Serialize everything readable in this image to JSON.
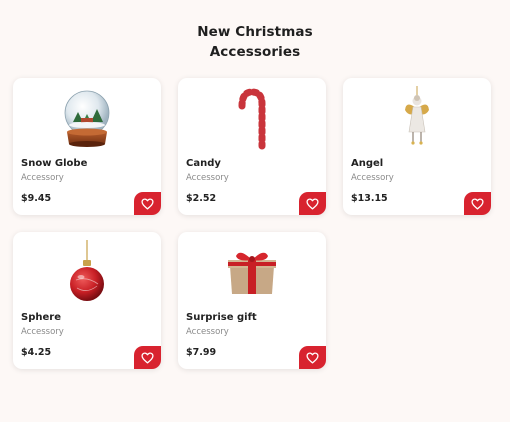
{
  "page": {
    "title_line1": "New Christmas",
    "title_line2": "Accessories"
  },
  "colors": {
    "accent": "#d8232f",
    "background": "#fdf8f6",
    "card": "#ffffff"
  },
  "products": [
    {
      "name": "Snow Globe",
      "category": "Accessory",
      "price": "$9.45",
      "icon": "snow-globe-icon"
    },
    {
      "name": "Candy",
      "category": "Accessory",
      "price": "$2.52",
      "icon": "candy-cane-icon"
    },
    {
      "name": "Angel",
      "category": "Accessory",
      "price": "$13.15",
      "icon": "angel-ornament-icon"
    },
    {
      "name": "Sphere",
      "category": "Accessory",
      "price": "$4.25",
      "icon": "bauble-icon"
    },
    {
      "name": "Surprise gift",
      "category": "Accessory",
      "price": "$7.99",
      "icon": "gift-box-icon"
    }
  ],
  "favorite_icon": "heart-icon"
}
